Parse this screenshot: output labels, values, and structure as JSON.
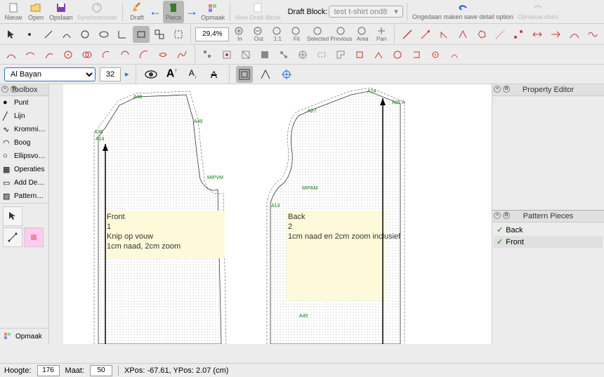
{
  "toolbar": {
    "nieuw": "Nieuw",
    "open": "Open",
    "opslaan": "Opslaan",
    "sync": "Synchroniseer",
    "draft": "Draft",
    "piece": "Piece",
    "opmaak": "Opmaak",
    "newdraft": "New Draft Block",
    "draftblock_label": "Draft Block:",
    "draftblock_value": "test t-shirt ond8",
    "undo": "Ongedaan maken save detail option",
    "redo": "Opnieuw doen"
  },
  "zoom": {
    "value": "29,4%",
    "in": "In",
    "out": "Out",
    "fit": "1:1",
    "fitlbl": "Fit",
    "selected": "Selected",
    "prev": "Previous",
    "area": "Area",
    "pan": "Pan"
  },
  "font": {
    "name": "Al Bayan",
    "size": "32"
  },
  "toolbox": {
    "title": "Toolbox",
    "items": [
      {
        "label": "Punt",
        "icon": "dot"
      },
      {
        "label": "Lijn",
        "icon": "line"
      },
      {
        "label": "Kromming",
        "icon": "curve"
      },
      {
        "label": "Boog",
        "icon": "arc"
      },
      {
        "label": "Ellipsvormi...",
        "icon": "ellipse"
      },
      {
        "label": "Operaties",
        "icon": "ops"
      },
      {
        "label": "Add Details",
        "icon": "details"
      },
      {
        "label": "Pattern Pie...",
        "icon": "pattern"
      }
    ],
    "opmaak": "Opmaak"
  },
  "property": {
    "title": "Property Editor"
  },
  "pieces": {
    "title": "Pattern Pieces",
    "items": [
      "Back",
      "Front"
    ]
  },
  "canvas": {
    "front": {
      "title": "Front",
      "num": "1",
      "line1": "Knip op vouw",
      "line2": "1cm naad, 2cm zoom"
    },
    "back": {
      "title": "Back",
      "num": "2",
      "line1": "1cm naad en 2cm zoom inclusief"
    },
    "points": {
      "a46": "A46",
      "a36": "A36",
      "a14": "A14",
      "a49": "A49",
      "mipvm": "MIPVM",
      "a27": "A27",
      "a24": "A24",
      "a25": "A25",
      "a": "A",
      "a13": "A13",
      "mipam": "MIPAM",
      "a45": "A45"
    }
  },
  "status": {
    "hoogte": "Hoogte:",
    "hoogte_val": "176",
    "maat": "Maat:",
    "maat_val": "50",
    "pos": "XPos: -67.61, YPos: 2.07 (cm)"
  }
}
